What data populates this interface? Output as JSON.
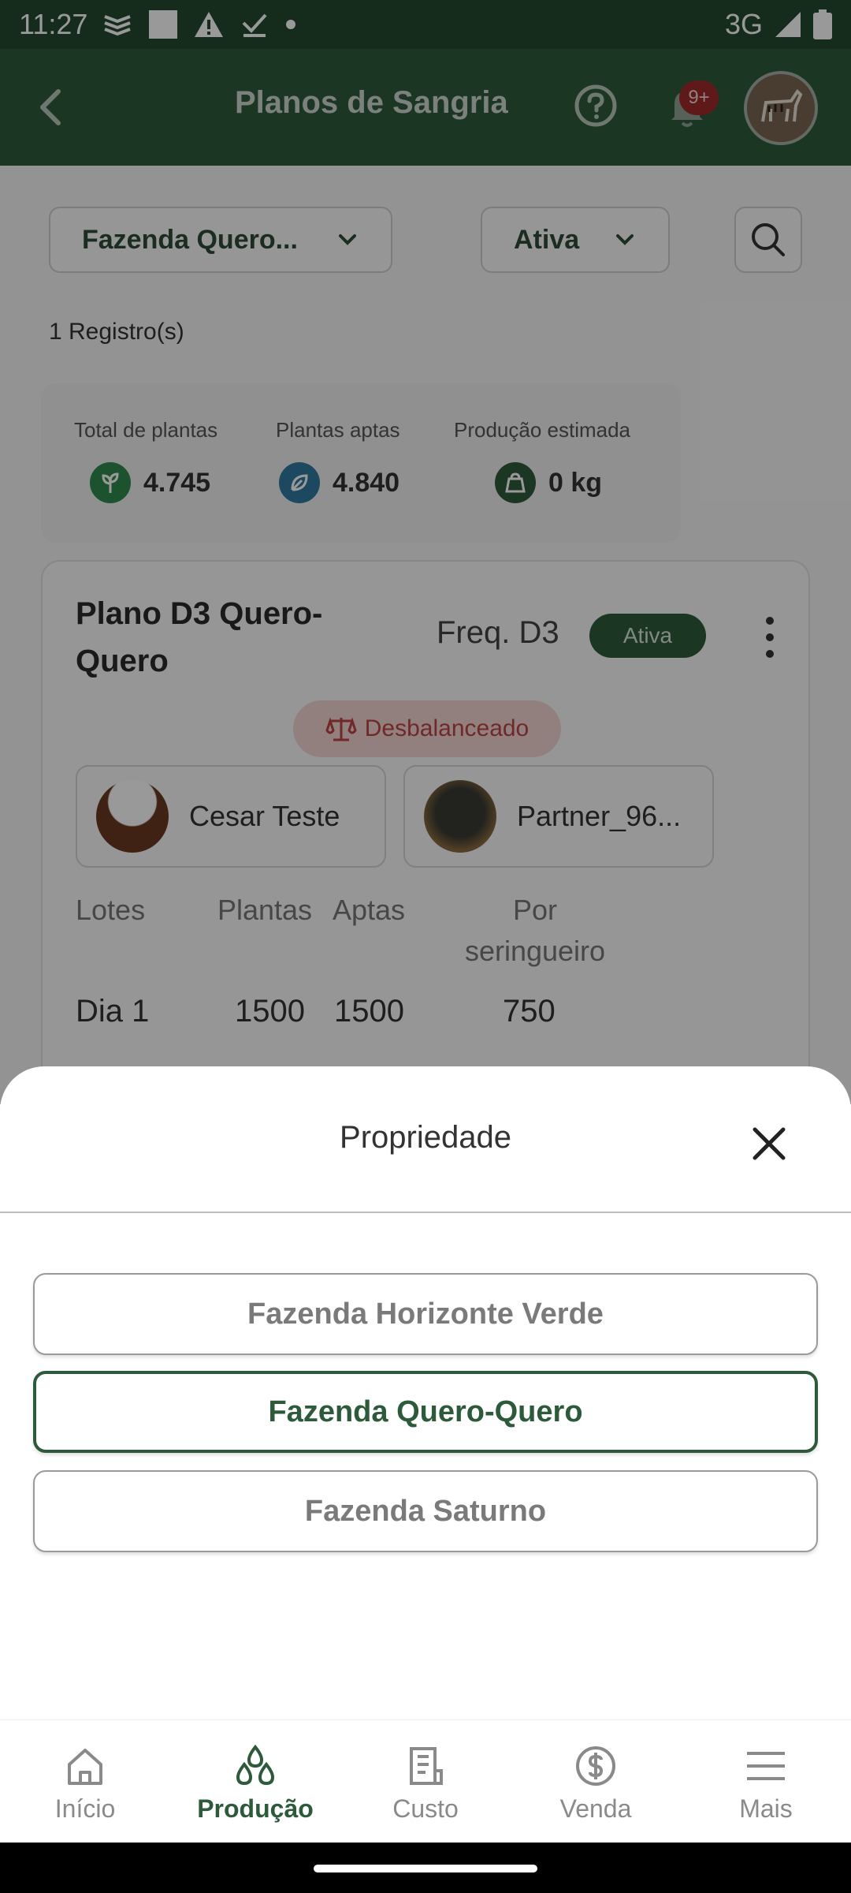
{
  "status_bar": {
    "time": "11:27",
    "network": "3G"
  },
  "app_bar": {
    "title": "Planos de Sangria",
    "notification_badge": "9+"
  },
  "filters": {
    "property": "Fazenda Quero...",
    "status": "Ativa"
  },
  "records_label": "1 Registro(s)",
  "stats": [
    {
      "label": "Total de plantas",
      "value": "4.745"
    },
    {
      "label": "Plantas aptas",
      "value": "4.840"
    },
    {
      "label": "Produção estimada",
      "value": "0 kg"
    }
  ],
  "plan": {
    "title": "Plano D3 Quero-Quero",
    "frequency": "Freq. D3",
    "status": "Ativa",
    "balance": "Desbalanceado",
    "tappers": [
      "Cesar Teste",
      "Partner_96..."
    ],
    "columns": [
      "Lotes",
      "Plantas",
      "Aptas",
      "Por seringueiro"
    ],
    "rows": [
      {
        "lote": "Dia 1",
        "plantas": "1500",
        "aptas": "1500",
        "por_seringueiro": "750"
      }
    ]
  },
  "sheet": {
    "title": "Propriedade",
    "options": [
      "Fazenda Horizonte Verde",
      "Fazenda Quero-Quero",
      "Fazenda Saturno"
    ],
    "selected": "Fazenda Quero-Quero"
  },
  "bottom_nav": [
    {
      "label": "Início",
      "icon": "home-icon"
    },
    {
      "label": "Produção",
      "icon": "drops-icon"
    },
    {
      "label": "Custo",
      "icon": "receipt-icon"
    },
    {
      "label": "Venda",
      "icon": "dollar-icon"
    },
    {
      "label": "Mais",
      "icon": "menu-icon"
    }
  ],
  "colors": {
    "primary": "#2d5a3a",
    "danger": "#a12a2a"
  }
}
